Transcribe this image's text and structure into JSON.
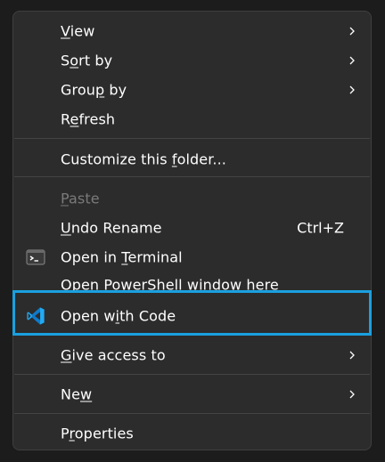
{
  "menu": {
    "items": [
      {
        "label": "View",
        "mnemonic": "V"
      },
      {
        "label": "Sort by",
        "mnemonic": "o"
      },
      {
        "label": "Group by",
        "mnemonic": "p"
      },
      {
        "label": "Refresh",
        "mnemonic": "e"
      },
      {
        "label": "Customize this folder...",
        "mnemonic": "F"
      },
      {
        "label": "Paste",
        "mnemonic": "P"
      },
      {
        "label": "Undo Rename",
        "mnemonic": "U",
        "shortcut": "Ctrl+Z"
      },
      {
        "label": "Open in Terminal",
        "mnemonic": "T"
      },
      {
        "label": "Open PowerShell window here"
      },
      {
        "label": "Open with Code",
        "mnemonic": "i"
      },
      {
        "label": "Give access to",
        "mnemonic": "G"
      },
      {
        "label": "New",
        "mnemonic": "w"
      },
      {
        "label": "Properties",
        "mnemonic": "r"
      }
    ]
  },
  "colors": {
    "menu_bg": "#2c2c2c",
    "text": "#ffffff",
    "disabled_text": "#7a7a7a",
    "separator": "#444444",
    "highlight_border": "#1aa0e0",
    "vscode_blue": "#23a9f2"
  },
  "icons": {
    "terminal": "terminal-icon",
    "vscode": "vscode-icon",
    "submenu": "chevron-right-icon"
  }
}
